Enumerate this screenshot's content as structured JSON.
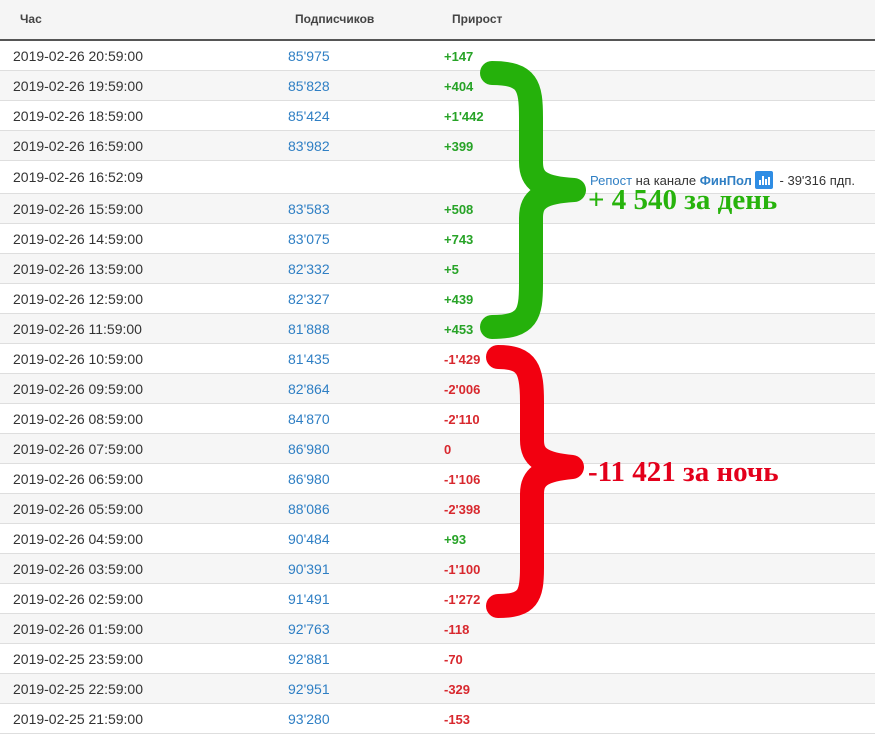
{
  "header": {
    "col_time": "Час",
    "col_subs": "Подписчиков",
    "col_growth": "Прирост"
  },
  "rows": [
    {
      "time": "2019-02-26 20:59:00",
      "subs": "85'975",
      "growth": "+147",
      "sign": "pos"
    },
    {
      "time": "2019-02-26 19:59:00",
      "subs": "85'828",
      "growth": "+404",
      "sign": "pos"
    },
    {
      "time": "2019-02-26 18:59:00",
      "subs": "85'424",
      "growth": "+1'442",
      "sign": "pos"
    },
    {
      "time": "2019-02-26 16:59:00",
      "subs": "83'982",
      "growth": "+399",
      "sign": "pos"
    },
    {
      "time": "2019-02-26 16:52:09",
      "subs": "",
      "growth": "",
      "sign": ""
    },
    {
      "time": "2019-02-26 15:59:00",
      "subs": "83'583",
      "growth": "+508",
      "sign": "pos"
    },
    {
      "time": "2019-02-26 14:59:00",
      "subs": "83'075",
      "growth": "+743",
      "sign": "pos"
    },
    {
      "time": "2019-02-26 13:59:00",
      "subs": "82'332",
      "growth": "+5",
      "sign": "pos"
    },
    {
      "time": "2019-02-26 12:59:00",
      "subs": "82'327",
      "growth": "+439",
      "sign": "pos"
    },
    {
      "time": "2019-02-26 11:59:00",
      "subs": "81'888",
      "growth": "+453",
      "sign": "pos"
    },
    {
      "time": "2019-02-26 10:59:00",
      "subs": "81'435",
      "growth": "-1'429",
      "sign": "neg"
    },
    {
      "time": "2019-02-26 09:59:00",
      "subs": "82'864",
      "growth": "-2'006",
      "sign": "neg"
    },
    {
      "time": "2019-02-26 08:59:00",
      "subs": "84'870",
      "growth": "-2'110",
      "sign": "neg"
    },
    {
      "time": "2019-02-26 07:59:00",
      "subs": "86'980",
      "growth": "0",
      "sign": "neg"
    },
    {
      "time": "2019-02-26 06:59:00",
      "subs": "86'980",
      "growth": "-1'106",
      "sign": "neg"
    },
    {
      "time": "2019-02-26 05:59:00",
      "subs": "88'086",
      "growth": "-2'398",
      "sign": "neg"
    },
    {
      "time": "2019-02-26 04:59:00",
      "subs": "90'484",
      "growth": "+93",
      "sign": "pos"
    },
    {
      "time": "2019-02-26 03:59:00",
      "subs": "90'391",
      "growth": "-1'100",
      "sign": "neg"
    },
    {
      "time": "2019-02-26 02:59:00",
      "subs": "91'491",
      "growth": "-1'272",
      "sign": "neg"
    },
    {
      "time": "2019-02-26 01:59:00",
      "subs": "92'763",
      "growth": "-118",
      "sign": "neg"
    },
    {
      "time": "2019-02-25 23:59:00",
      "subs": "92'881",
      "growth": "-70",
      "sign": "neg"
    },
    {
      "time": "2019-02-25 22:59:00",
      "subs": "92'951",
      "growth": "-329",
      "sign": "neg"
    },
    {
      "time": "2019-02-25 21:59:00",
      "subs": "93'280",
      "growth": "-153",
      "sign": "neg"
    }
  ],
  "repost": {
    "repost_label": "Репост",
    "middle_text": " на канале ",
    "channel_name": "ФинПол",
    "icon": "stats-chart-icon",
    "suffix": " - 39'316 пдп."
  },
  "annotations": {
    "day_caption": "+ 4 540 за день",
    "night_caption": "-11 421 за ночь",
    "day_color": "#27b30c",
    "night_color": "#e3001b"
  }
}
